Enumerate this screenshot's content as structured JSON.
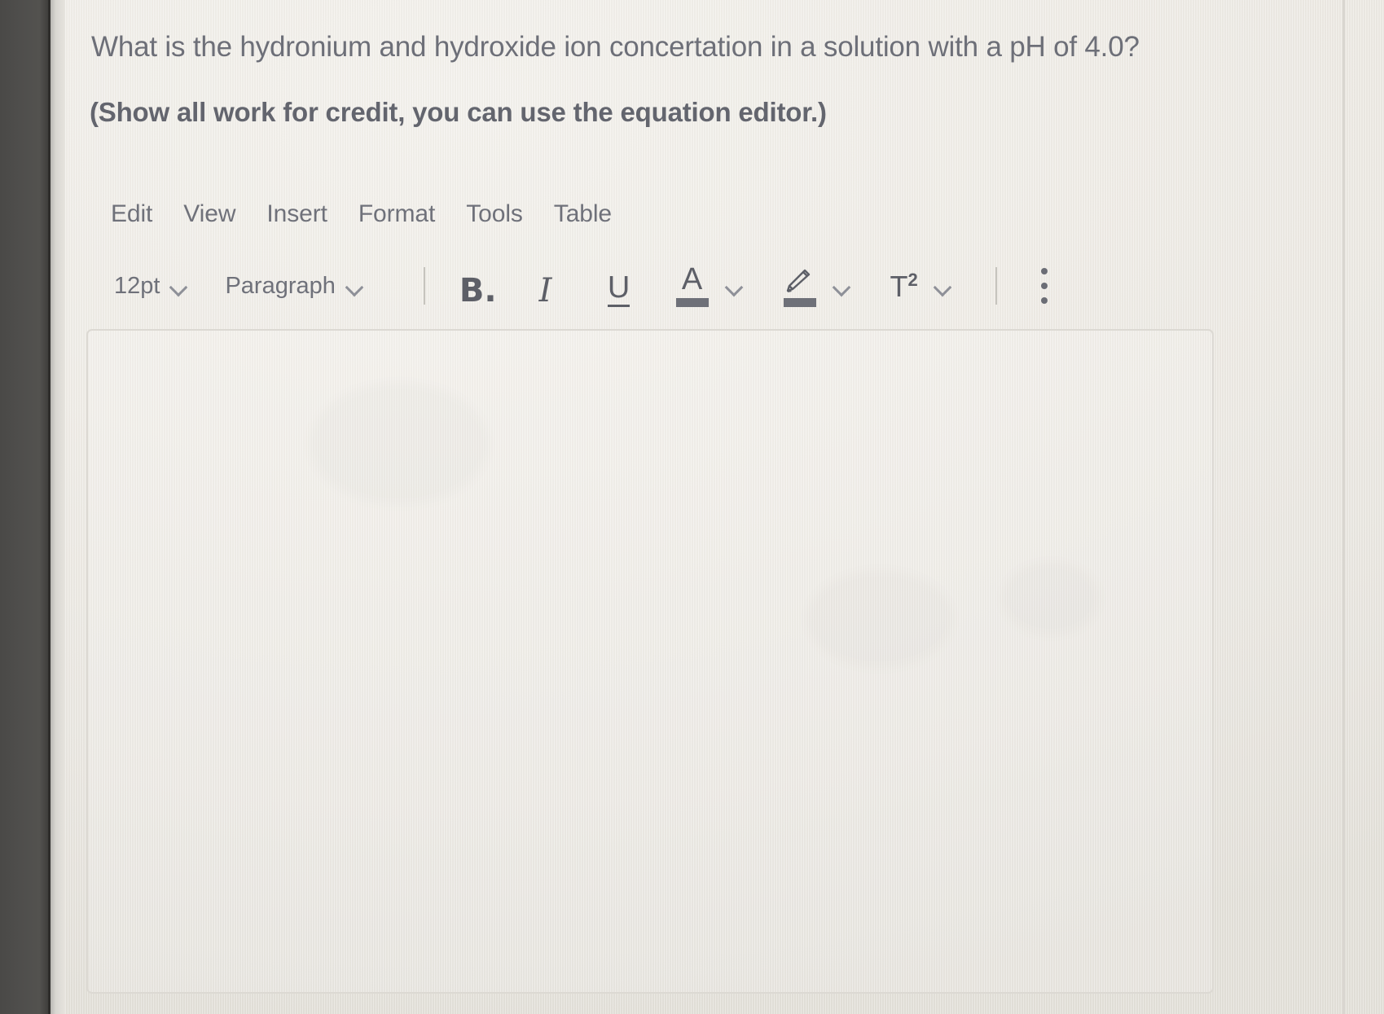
{
  "question": {
    "line1": "What is the hydronium and hydroxide ion concertation in a solution with a pH of 4.0?",
    "line2": "(Show all work for credit, you can use the equation editor.)"
  },
  "editor": {
    "menubar": [
      {
        "label": "Edit"
      },
      {
        "label": "View"
      },
      {
        "label": "Insert"
      },
      {
        "label": "Format"
      },
      {
        "label": "Tools"
      },
      {
        "label": "Table"
      }
    ],
    "toolbar": {
      "font_size": "12pt",
      "block_format": "Paragraph",
      "bold_label": "B.",
      "italic_label": "I",
      "underline_label": "U",
      "text_color_label": "A",
      "superscript_label": "T",
      "superscript_exponent": "2",
      "more_options_label": "⋮"
    },
    "body_text": "",
    "body_placeholder": ""
  },
  "colors": {
    "page_background": "#eeebe5",
    "text": "#6d6f78",
    "toolbar_icon": "#5d5f67",
    "chevron": "#8e9098",
    "divider": "#c6c4be",
    "editor_border": "#dcd9d3",
    "bezel": "#4f4e4c"
  }
}
